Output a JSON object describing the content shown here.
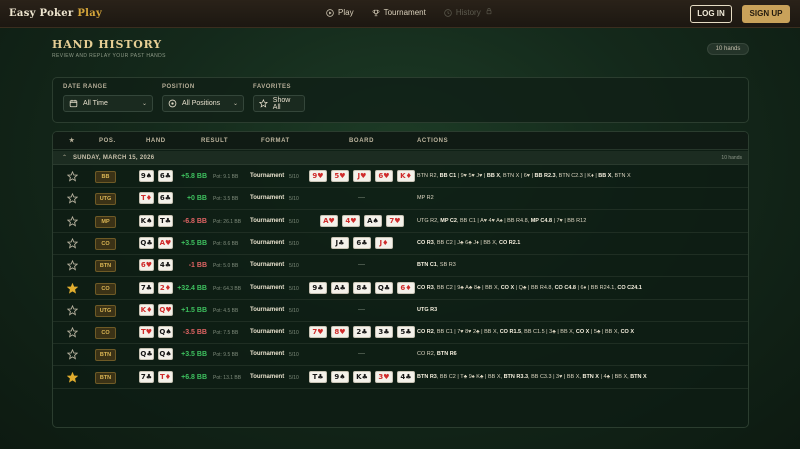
{
  "nav": {
    "logo_main": "Easy Poker",
    "logo_accent": "Play",
    "links": [
      {
        "label": "Play",
        "icon": "play-circle-icon",
        "enabled": true
      },
      {
        "label": "Tournament",
        "icon": "trophy-icon",
        "enabled": true
      },
      {
        "label": "History",
        "icon": "clock-icon",
        "enabled": false
      }
    ],
    "login": "LOG IN",
    "signup": "SIGN UP"
  },
  "header": {
    "title": "HAND HISTORY",
    "subtitle": "REVIEW AND REPLAY YOUR PAST HANDS",
    "count": "10 hands"
  },
  "filters": {
    "date_range": {
      "label": "DATE RANGE",
      "value": "All Time"
    },
    "position": {
      "label": "POSITION",
      "value": "All Positions"
    },
    "favorites": {
      "label": "FAVORITES",
      "value": "Show All"
    }
  },
  "table": {
    "columns": {
      "star": "★",
      "pos": "POS.",
      "hand": "HAND",
      "result": "RESULT",
      "format": "FORMAT",
      "board": "BOARD",
      "actions": "ACTIONS"
    },
    "group": {
      "date": "SUNDAY, MARCH 15, 2026",
      "count": "10 hands"
    },
    "rows": [
      {
        "fav": false,
        "pos": "BB",
        "hand": [
          "9♠",
          "6♣"
        ],
        "result": "+5.8 BB",
        "sign": "pos",
        "pot": "Pot: 9.1 BB",
        "format": "Tournament",
        "stake": "5/10",
        "board": [
          "9♥",
          "5♥",
          "J♥",
          "6♥",
          "K♦"
        ],
        "actions": [
          [
            "BTN R2, ",
            0
          ],
          [
            "BB C1",
            1
          ],
          [
            " | 9♥ 5♥ J♥ | ",
            0
          ],
          [
            "BB X",
            1
          ],
          [
            ", BTN X | 6♥ | ",
            0
          ],
          [
            "BB R2.3",
            1
          ],
          [
            ", BTN C2.3 | K♦ | ",
            0
          ],
          [
            "BB X",
            1
          ],
          [
            ", BTN X",
            0
          ]
        ]
      },
      {
        "fav": false,
        "pos": "UTG",
        "hand": [
          "T♦",
          "6♣"
        ],
        "result": "+0 BB",
        "sign": "zero",
        "pot": "Pot: 3.5 BB",
        "format": "Tournament",
        "stake": "5/10",
        "board": null,
        "actions": [
          [
            "MP R2",
            0
          ]
        ]
      },
      {
        "fav": false,
        "pos": "MP",
        "hand": [
          "K♠",
          "T♣"
        ],
        "result": "-6.8 BB",
        "sign": "neg",
        "pot": "Pot: 26.1 BB",
        "format": "Tournament",
        "stake": "5/10",
        "board": [
          "A♥",
          "4♥",
          "A♠",
          "7♥"
        ],
        "actions": [
          [
            "UTG R2, ",
            0
          ],
          [
            "MP C2",
            1
          ],
          [
            ", BB C1 | A♥ 4♥ A♠ | BB R4.8, ",
            0
          ],
          [
            "MP C4.8",
            1
          ],
          [
            " | 7♥ | BB R12",
            0
          ]
        ]
      },
      {
        "fav": false,
        "pos": "CO",
        "hand": [
          "Q♣",
          "A♥"
        ],
        "result": "+3.5 BB",
        "sign": "pos",
        "pot": "Pot: 8.6 BB",
        "format": "Tournament",
        "stake": "5/10",
        "board": [
          "J♣",
          "6♣",
          "J♦"
        ],
        "actions": [
          [
            "CO R3",
            1
          ],
          [
            ", BB C2 | J♣ 6♣ J♦ | BB X, ",
            0
          ],
          [
            "CO R2.1",
            1
          ]
        ]
      },
      {
        "fav": false,
        "pos": "BTN",
        "hand": [
          "6♥",
          "4♣"
        ],
        "result": "-1 BB",
        "sign": "neg",
        "pot": "Pot: 5.0 BB",
        "format": "Tournament",
        "stake": "5/10",
        "board": null,
        "actions": [
          [
            "BTN C1",
            1
          ],
          [
            ", SB R3",
            0
          ]
        ]
      },
      {
        "fav": true,
        "pos": "CO",
        "hand": [
          "7♣",
          "2♦"
        ],
        "result": "+32.4 BB",
        "sign": "pos",
        "pot": "Pot: 64.3 BB",
        "format": "Tournament",
        "stake": "5/10",
        "board": [
          "9♣",
          "A♣",
          "8♣",
          "Q♣",
          "6♦"
        ],
        "actions": [
          [
            "CO R3",
            1
          ],
          [
            ", BB C2 | 9♣ A♣ 8♣ | BB X, ",
            0
          ],
          [
            "CO X",
            1
          ],
          [
            " | Q♣ | BB R4.8, ",
            0
          ],
          [
            "CO C4.8",
            1
          ],
          [
            " | 6♦ | BB R24.1, ",
            0
          ],
          [
            "CO C24.1",
            1
          ]
        ]
      },
      {
        "fav": false,
        "pos": "UTG",
        "hand": [
          "K♦",
          "Q♥"
        ],
        "result": "+1.5 BB",
        "sign": "pos",
        "pot": "Pot: 4.5 BB",
        "format": "Tournament",
        "stake": "5/10",
        "board": null,
        "actions": [
          [
            "UTG R3",
            1
          ]
        ]
      },
      {
        "fav": false,
        "pos": "CO",
        "hand": [
          "T♥",
          "Q♠"
        ],
        "result": "-3.5 BB",
        "sign": "neg",
        "pot": "Pot: 7.5 BB",
        "format": "Tournament",
        "stake": "5/10",
        "board": [
          "7♥",
          "8♥",
          "2♣",
          "3♣",
          "5♣"
        ],
        "actions": [
          [
            "CO R2",
            1
          ],
          [
            ", BB C1 | 7♥ 8♥ 2♣ | BB X, ",
            0
          ],
          [
            "CO R1.5",
            1
          ],
          [
            ", BB C1.5 | 3♣ | BB X, ",
            0
          ],
          [
            "CO X",
            1
          ],
          [
            " | 5♣ | BB X, ",
            0
          ],
          [
            "CO X",
            1
          ]
        ]
      },
      {
        "fav": false,
        "pos": "BTN",
        "hand": [
          "Q♣",
          "Q♠"
        ],
        "result": "+3.5 BB",
        "sign": "pos",
        "pot": "Pot: 9.5 BB",
        "format": "Tournament",
        "stake": "5/10",
        "board": null,
        "actions": [
          [
            "CO R2, ",
            0
          ],
          [
            "BTN R6",
            1
          ]
        ]
      },
      {
        "fav": true,
        "pos": "BTN",
        "hand": [
          "7♣",
          "T♦"
        ],
        "result": "+6.8 BB",
        "sign": "pos",
        "pot": "Pot: 13.1 BB",
        "format": "Tournament",
        "stake": "5/10",
        "board": [
          "T♣",
          "9♠",
          "K♣",
          "3♥",
          "4♣"
        ],
        "actions": [
          [
            "BTN R3",
            1
          ],
          [
            ", BB C2 | T♣ 9♠ K♣ | BB X, ",
            0
          ],
          [
            "BTN R3.3",
            1
          ],
          [
            ", BB C3.3 | 3♥ | BB X, ",
            0
          ],
          [
            "BTN X",
            1
          ],
          [
            " | 4♣ | BB X, ",
            0
          ],
          [
            "BTN X",
            1
          ]
        ]
      }
    ]
  },
  "colors": {
    "gold": "#d4a53a",
    "win": "#3ec15f",
    "loss": "#e06464",
    "red_suit": "#cf2b2b",
    "star_fav": "#e1ad2e",
    "star_empty": "#b8b29f"
  }
}
